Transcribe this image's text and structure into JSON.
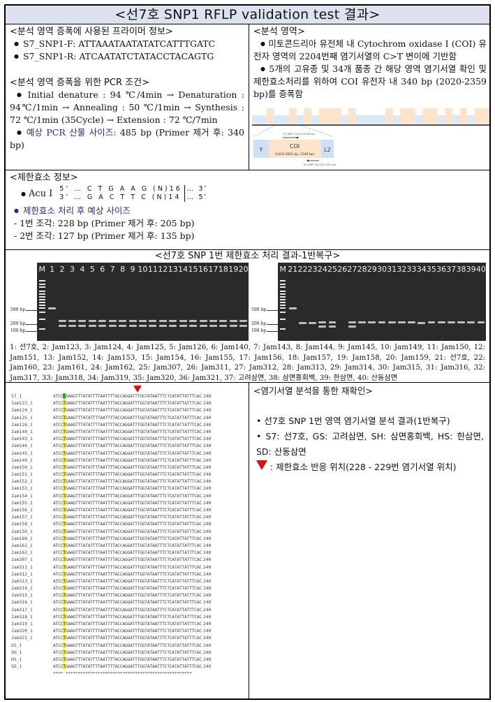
{
  "title": "<선7호 SNP1 RFLP validation test 결과>",
  "primer_info": {
    "heading": "<분석 영역 증폭에 사용된 프라이머 정보>",
    "primers": [
      {
        "name": "S7_SNP1-F:",
        "seq": "ATTAAATAATATATCATTTGATC"
      },
      {
        "name": "S7_SNP1-R:",
        "seq": "ATCAATATCTATACCTACAGTG"
      }
    ]
  },
  "pcr": {
    "heading": "<분석 영역 증폭을 위한 PCR 조건>",
    "conditions": "Initial denature : 94 ℃/4min → Denaturation : 94℃/1min → Annealing : 50 ℃/1min → Synthesis : 72 ℃/1min (35Cycle) → Extension : 72 ℃/7min",
    "expected_label": "예상 PCR 산물 사이즈:",
    "expected_value": "485 bp (Primer 제거 후: 340 bp)"
  },
  "region": {
    "heading": "<분석 영역>",
    "bullets": [
      "미토콘드리아 유전체 내 Cytochrom oxidase I (COI) 유전자 영역의 2204번째 염기서열의 C>T 변이에 기반함",
      "5개의 고유종 및 34개 품종 간 해당 영역 염기서열 확인 및 제한효소처리를 위하여 COI 유전자 내 340 bp (2020-2359 bp)를 증폭함"
    ],
    "map": {
      "left_gene": "Y",
      "center_gene": "COI",
      "center_range": "(1454-3001 bp, 1548 bp)",
      "right_gene": "L2",
      "forward_primer_label": "S7_SNP1-F(2020-2046 bp)",
      "reverse_primer_label": "S7_SNP1-R(2333-2359 bp)"
    }
  },
  "enzyme": {
    "heading": "<제한효소 정보>",
    "name": "Acu I",
    "top_strand": "5’ … C T G A A G (N)16",
    "top_end": "… 3’",
    "bottom_strand": "3’ … G A C T T C (N)14",
    "bottom_end": "… 5’",
    "expected_heading": "제한효소 처리 후 예상 사이즈",
    "fragments": [
      "- 1번 조각: 228 bp (Primer 제거 후: 205 bp)",
      "- 2번 조각: 127 bp (Primer 제거 후: 135 bp)"
    ]
  },
  "gel_section": {
    "heading": "<선7호 SNP 1번 제한효소 처리 결과-1반복구>",
    "marker_labels": [
      "500 bp",
      "200 bp",
      "100 bp"
    ],
    "gel1_lanes": [
      "M",
      "1",
      "2",
      "3",
      "4",
      "5",
      "6",
      "7",
      "8",
      "9",
      "10",
      "11",
      "12",
      "13",
      "14",
      "15",
      "16",
      "17",
      "18",
      "19",
      "20"
    ],
    "gel2_lanes": [
      "M",
      "21",
      "22",
      "23",
      "24",
      "25",
      "26",
      "27",
      "28",
      "29",
      "30",
      "31",
      "32",
      "33",
      "34",
      "35",
      "36",
      "37",
      "38",
      "39",
      "40"
    ],
    "legend": "1: 선7호, 2: Jam123, 3: Jam124, 4: Jam125, 5: Jam126, 6: Jam140, 7: Jam143, 8: Jam144, 9: Jam145, 10: Jam149, 11: Jam150, 12: Jam151, 13: Jam152, 14: Jam153, 15: Jam154, 16: Jam155, 17: Jam156, 18: Jam157, 19: Jam158, 20: Jam159, 21: 선7호, 22: Jam160, 23: Jam161, 24: Jam162, 25: Jam307, 26: Jam311, 27: Jam312, 28: Jam313, 29: Jam314, 30: Jam315, 31: Jam316, 32: Jam317, 33: Jam318, 34: Jam319, 35: Jam320, 36: Jam321, 37: 고려삼면, 38: 삼면홍회백, 39: 한삼면, 40: 산동삼면"
  },
  "alignment": {
    "prefix_ref": "ATCC",
    "snp_ref": "C",
    "snp_alt": "T",
    "suffix": "GAAGTTTATATTTTAATTTTACCAGGATTTGGTATAATTTCTCATATTATTTCAC",
    "end_pos": "240",
    "consensus": "**** ***************************************************",
    "rows": [
      "S7_1",
      "Jam123_1",
      "Jam124_1",
      "Jam125_1",
      "Jam126_1",
      "Jam140_1",
      "Jam143_1",
      "Jam144_1",
      "Jam145_1",
      "Jam149_1",
      "Jam150_1",
      "Jam151_1",
      "Jam152_1",
      "Jam153_1",
      "Jam154_1",
      "Jam155_1",
      "Jam156_1",
      "Jam157_1",
      "Jam158_1",
      "Jam159_1",
      "Jam160_1",
      "Jam161_1",
      "Jam162_1",
      "Jam307_1",
      "Jam311_1",
      "Jam312_1",
      "Jam313_1",
      "Jam314_1",
      "Jam315_1",
      "Jam316_1",
      "Jam317_1",
      "Jam318_1",
      "Jam319_1",
      "Jam320_1",
      "Jam321_1",
      "GS_1",
      "SH_1",
      "HS_1",
      "SD_1"
    ]
  },
  "reconfirm": {
    "heading": "<염기서열 분석을 통한 재확인>",
    "bullets": [
      "선7호 SNP 1번 영역 염기서열 분석 결과(1반복구)",
      "S7: 선7호, GS: 고려삼면, SH: 삼면홍회백, HS: 한삼면, SD: 산동삼면"
    ],
    "marker_note": ": 제한효소 반응 위치(228 - 229번 염기서열 위치)"
  },
  "colors": {
    "header_bg": "#dde1f0",
    "snp_ref_highlight": "#33cc33",
    "snp_alt_highlight": "#f2f200",
    "cut_marker": "#e01010"
  }
}
